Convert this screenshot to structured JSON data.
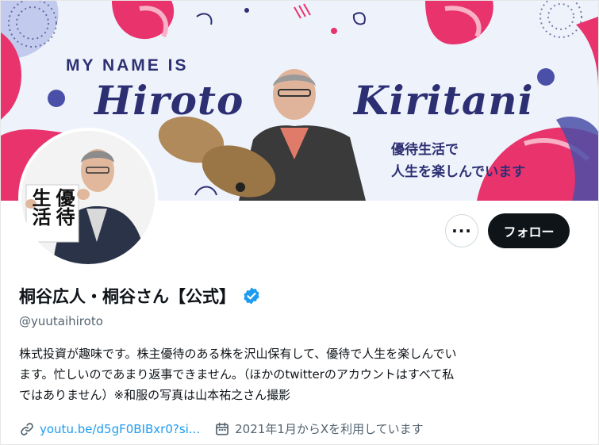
{
  "banner": {
    "intro": "MY NAME IS",
    "first_name": "Hiroto",
    "last_name": "Kiritani",
    "tagline_line1": "優待生活で",
    "tagline_line2": "人生を楽しんでいます"
  },
  "avatar": {
    "calligraphy": "優待生活"
  },
  "actions": {
    "more_label": "···",
    "follow_label": "フォロー"
  },
  "profile": {
    "display_name": "桐谷広人・桐谷さん【公式】",
    "handle": "@yuutaihiroto",
    "bio_line1": "株式投資が趣味です。株主優待のある株を沢山保有して、優待で人生を楽しんでい",
    "bio_line2": "ます。忙しいのであまり返事できません。（ほかのtwitterのアカウントはすべて私",
    "bio_line3": "ではありません）※和服の写真は山本祐之さん撮影",
    "link_text": "youtu.be/d5gF0BIBxr0?si...",
    "joined_text": "2021年1月からXを利用しています"
  },
  "colors": {
    "accent_blue": "#1d9bf0",
    "follow_bg": "#0f1419",
    "banner_pink": "#e8336d",
    "banner_navy": "#2d2f73"
  }
}
